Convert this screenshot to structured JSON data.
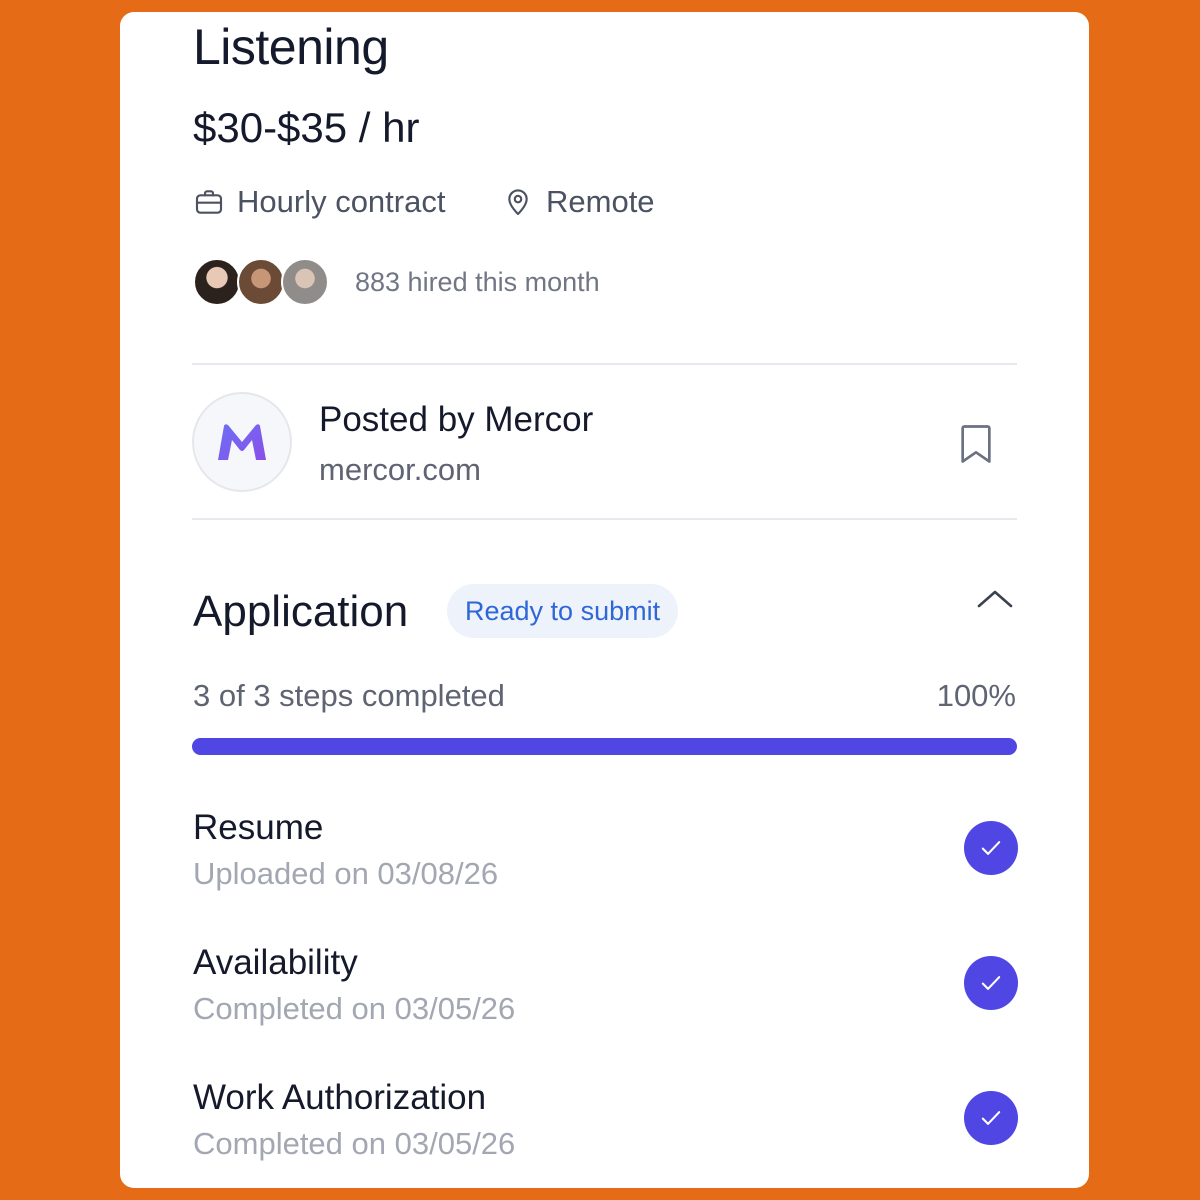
{
  "job": {
    "title": "Listening",
    "pay": "$30-$35 / hr",
    "contract_type": "Hourly contract",
    "location": "Remote",
    "hired_text": "883 hired this month"
  },
  "poster": {
    "label": "Posted by Mercor",
    "domain": "mercor.com",
    "logo_letter": "M"
  },
  "application": {
    "title": "Application",
    "status_badge": "Ready to submit",
    "steps_text": "3 of 3 steps completed",
    "percent_text": "100%",
    "progress": 1.0,
    "steps": [
      {
        "name": "Resume",
        "date": "Uploaded on 03/08/26",
        "completed": true
      },
      {
        "name": "Availability",
        "date": "Completed on 03/05/26",
        "completed": true
      },
      {
        "name": "Work Authorization",
        "date": "Completed on 03/05/26",
        "completed": true
      }
    ]
  },
  "colors": {
    "background": "#E56B16",
    "accent": "#5046E4",
    "badge_text": "#2F68D6",
    "badge_bg": "#EDF2FB"
  },
  "icons": {
    "contract": "briefcase-icon",
    "location": "map-pin-icon",
    "save": "bookmark-icon",
    "collapse": "chevron-up-icon",
    "step_done": "check-icon"
  }
}
